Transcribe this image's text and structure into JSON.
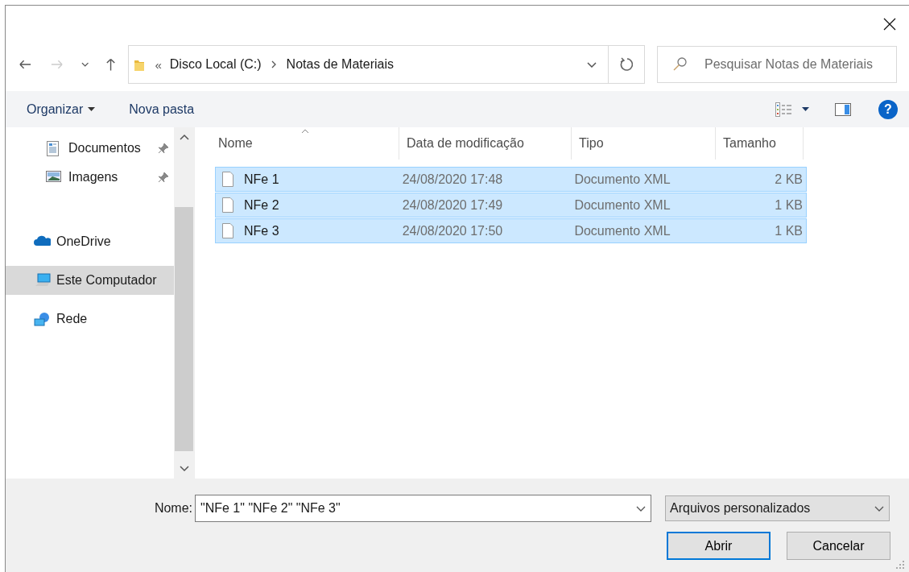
{
  "nav": {
    "overflow": "«",
    "breadcrumb": [
      {
        "label": "Disco Local (C:)"
      },
      {
        "label": "Notas de Materiais"
      }
    ],
    "search": {
      "placeholder": "Pesquisar Notas de Materiais"
    }
  },
  "toolbar": {
    "organize": "Organizar",
    "new_folder": "Nova pasta",
    "help": "?"
  },
  "sidebar": {
    "quick_access": [
      {
        "label": "Documentos",
        "kind": "documents",
        "pinned": true,
        "selected": false
      },
      {
        "label": "Imagens",
        "kind": "pictures",
        "pinned": true,
        "selected": false
      }
    ],
    "locations": [
      {
        "label": "OneDrive",
        "kind": "cloud",
        "selected": false
      },
      {
        "label": "Este Computador",
        "kind": "computer",
        "selected": true
      },
      {
        "label": "Rede",
        "kind": "network",
        "selected": false
      }
    ]
  },
  "columns": [
    {
      "label": "Nome",
      "sorted": true
    },
    {
      "label": "Data de modificação",
      "sorted": false
    },
    {
      "label": "Tipo",
      "sorted": false
    },
    {
      "label": "Tamanho",
      "sorted": false
    }
  ],
  "rows": [
    {
      "name": "NFe 1",
      "date": "24/08/2020 17:48",
      "type": "Documento XML",
      "size": "2 KB",
      "selected": true
    },
    {
      "name": "NFe 2",
      "date": "24/08/2020 17:49",
      "type": "Documento XML",
      "size": "1 KB",
      "selected": true
    },
    {
      "name": "NFe 3",
      "date": "24/08/2020 17:50",
      "type": "Documento XML",
      "size": "1 KB",
      "selected": true
    }
  ],
  "footer": {
    "filename_label": "Nome:",
    "filename": "\"NFe 1\" \"NFe 2\" \"NFe 3\"",
    "filter": "Arquivos personalizados",
    "buttons": [
      {
        "label": "Abrir",
        "default": true
      },
      {
        "label": "Cancelar",
        "default": false
      }
    ]
  }
}
